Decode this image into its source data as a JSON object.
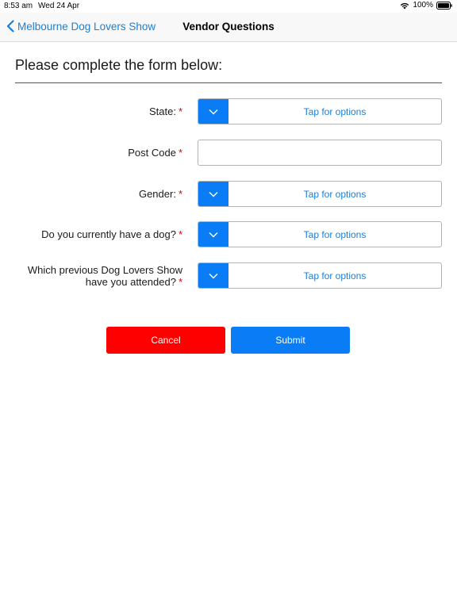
{
  "status": {
    "time": "8:53 am",
    "date": "Wed 24 Apr",
    "battery": "100%"
  },
  "nav": {
    "back_label": "Melbourne Dog Lovers Show",
    "title": "Vendor Questions"
  },
  "form": {
    "heading": "Please complete the form below:",
    "required_mark": "*",
    "fields": [
      {
        "label": "State:",
        "type": "picker",
        "value": "Tap for options"
      },
      {
        "label": "Post Code",
        "type": "text",
        "value": ""
      },
      {
        "label": "Gender:",
        "type": "picker",
        "value": "Tap for options"
      },
      {
        "label": "Do you currently have a dog?",
        "type": "picker",
        "value": "Tap for options"
      },
      {
        "label_line1": "Which previous Dog Lovers Show",
        "label_line2": "have you attended?",
        "type": "picker",
        "value": "Tap for options"
      }
    ]
  },
  "buttons": {
    "cancel": "Cancel",
    "submit": "Submit"
  },
  "colors": {
    "accent": "#0a7cf5",
    "link": "#1a7fd6",
    "cancel": "#ff0000",
    "required": "#e00000"
  }
}
